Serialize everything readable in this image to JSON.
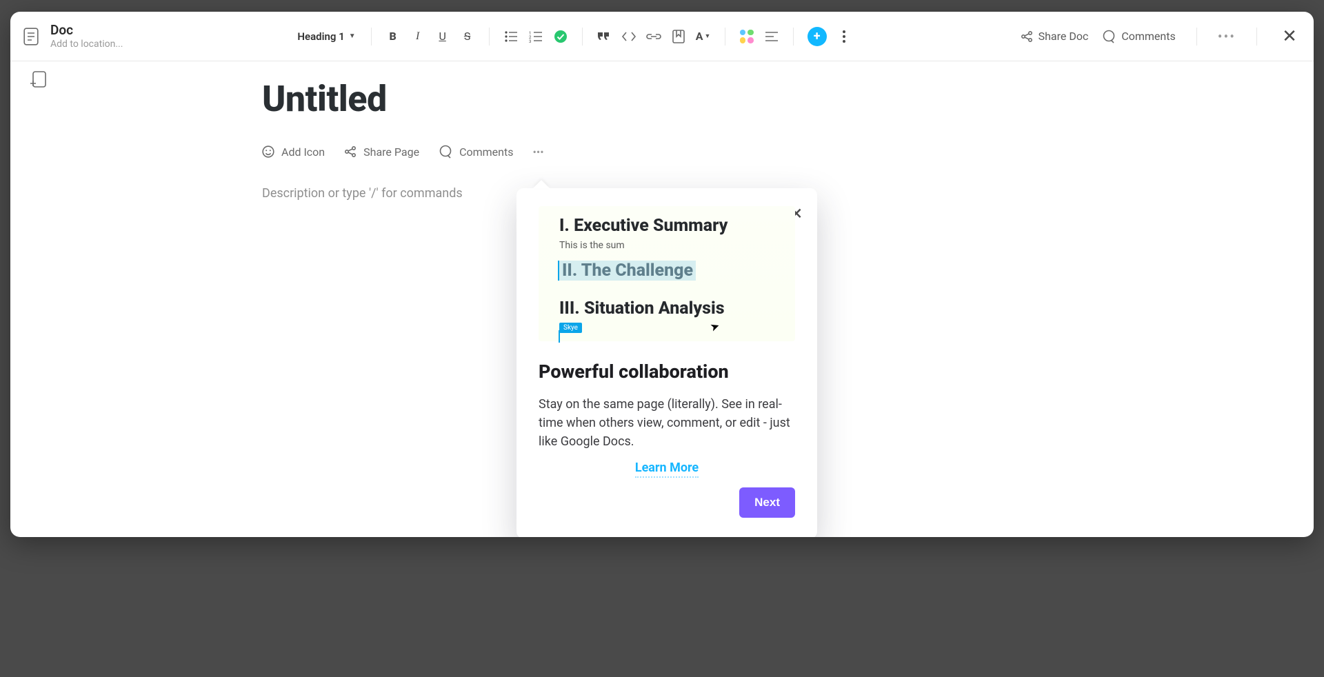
{
  "header": {
    "doc_label": "Doc",
    "location_placeholder": "Add to location...",
    "heading_select_label": "Heading 1",
    "share_doc_label": "Share Doc",
    "comments_label": "Comments"
  },
  "document": {
    "title": "Untitled",
    "description_placeholder": "Description or type '/' for commands",
    "actions": {
      "add_icon": "Add Icon",
      "share_page": "Share Page",
      "comments": "Comments"
    }
  },
  "popover": {
    "preview": {
      "h1": "I. Executive Summary",
      "h1_body": "This is the sum",
      "h2": "II. The Challenge",
      "h3": "III. Situation Analysis",
      "user_flag": "Skye"
    },
    "title": "Powerful collaboration",
    "body": "Stay on the same page (literally). See in real-time when others view, comment, or edit - just like Google Docs.",
    "learn_more": "Learn More",
    "next": "Next"
  },
  "icons": {
    "doc": "doc-icon",
    "bold": "B",
    "italic": "I",
    "underline": "U",
    "strike": "S"
  },
  "colors": {
    "accent_blue": "#12b8ff",
    "accent_purple": "#7d5cff",
    "check_green": "#28c76f"
  }
}
